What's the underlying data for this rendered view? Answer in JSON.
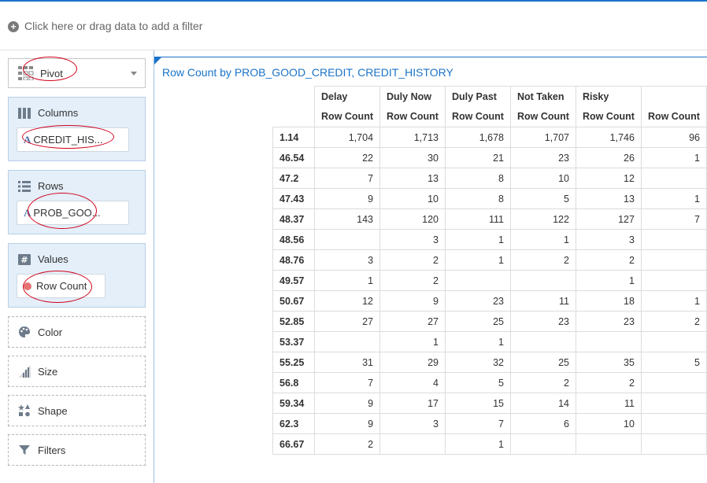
{
  "filter_bar": {
    "text": "Click here or drag data to add a filter"
  },
  "left_panel": {
    "viz_type": "Pivot",
    "columns": {
      "title": "Columns",
      "item": "CREDIT_HIS..."
    },
    "rows": {
      "title": "Rows",
      "item": "PROB_GOO..."
    },
    "values": {
      "title": "Values",
      "item": "Row Count"
    },
    "drop_zones": [
      "Color",
      "Size",
      "Shape",
      "Filters"
    ]
  },
  "viz": {
    "title": "Row Count by PROB_GOOD_CREDIT, CREDIT_HISTORY",
    "columns": [
      "Delay",
      "Duly Now",
      "Duly Past",
      "Not Taken",
      "Risky",
      ""
    ],
    "measure": "Row Count",
    "rows": [
      {
        "key": "1.14",
        "values": [
          "1,704",
          "1,713",
          "1,678",
          "1,707",
          "1,746",
          "96"
        ]
      },
      {
        "key": "46.54",
        "values": [
          "22",
          "30",
          "21",
          "23",
          "26",
          "1"
        ]
      },
      {
        "key": "47.2",
        "values": [
          "7",
          "13",
          "8",
          "10",
          "12",
          ""
        ]
      },
      {
        "key": "47.43",
        "values": [
          "9",
          "10",
          "8",
          "5",
          "13",
          "1"
        ]
      },
      {
        "key": "48.37",
        "values": [
          "143",
          "120",
          "111",
          "122",
          "127",
          "7"
        ]
      },
      {
        "key": "48.56",
        "values": [
          "",
          "3",
          "1",
          "1",
          "3",
          ""
        ]
      },
      {
        "key": "48.76",
        "values": [
          "3",
          "2",
          "1",
          "2",
          "2",
          ""
        ]
      },
      {
        "key": "49.57",
        "values": [
          "1",
          "2",
          "",
          "",
          "1",
          ""
        ]
      },
      {
        "key": "50.67",
        "values": [
          "12",
          "9",
          "23",
          "11",
          "18",
          "1"
        ]
      },
      {
        "key": "52.85",
        "values": [
          "27",
          "27",
          "25",
          "23",
          "23",
          "2"
        ]
      },
      {
        "key": "53.37",
        "values": [
          "",
          "1",
          "1",
          "",
          "",
          ""
        ]
      },
      {
        "key": "55.25",
        "values": [
          "31",
          "29",
          "32",
          "25",
          "35",
          "5"
        ]
      },
      {
        "key": "56.8",
        "values": [
          "7",
          "4",
          "5",
          "2",
          "2",
          ""
        ]
      },
      {
        "key": "59.34",
        "values": [
          "9",
          "17",
          "15",
          "14",
          "11",
          ""
        ]
      },
      {
        "key": "62.3",
        "values": [
          "9",
          "3",
          "7",
          "6",
          "10",
          ""
        ]
      },
      {
        "key": "66.67",
        "values": [
          "2",
          "",
          "1",
          "",
          "",
          ""
        ]
      }
    ]
  },
  "colors": {
    "accent": "#1a73c9",
    "section_bg": "#e4effa",
    "annotation": "#d0021b"
  }
}
